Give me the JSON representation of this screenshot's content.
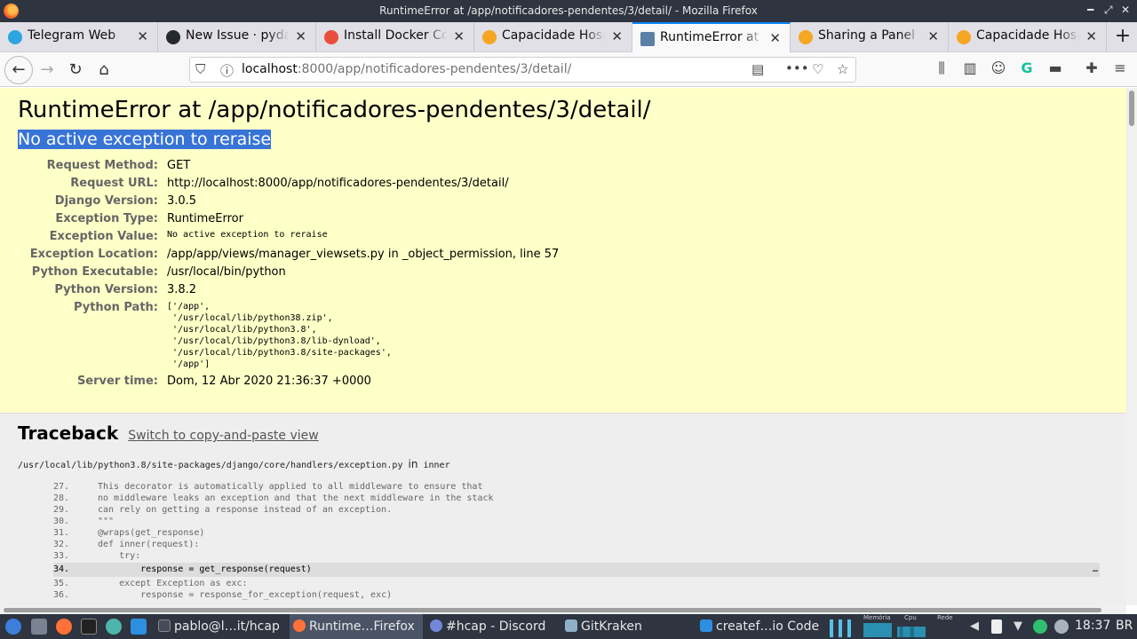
{
  "window": {
    "title": "RuntimeError at /app/notificadores-pendentes/3/detail/ - Mozilla Firefox"
  },
  "window_controls": {
    "minimize": "━",
    "maximize": "⤢",
    "close": "✕"
  },
  "tabs": [
    {
      "label": "Telegram Web",
      "color": "#2ca5e0"
    },
    {
      "label": "New Issue · pydantic",
      "color": "#24292e"
    },
    {
      "label": "Install Docker Compose",
      "color": "#e94e3c"
    },
    {
      "label": "Capacidade Hospitalar",
      "color": "#f5a623"
    },
    {
      "label": "RuntimeError at /app/",
      "color": "#5b7fa6"
    },
    {
      "label": "Sharing a Panel | Grafana",
      "color": "#f5a623"
    },
    {
      "label": "Capacidade Hospitalar",
      "color": "#f5a623"
    }
  ],
  "tab_close_glyph": "✕",
  "new_tab_glyph": "+",
  "nav": {
    "back": "←",
    "forward": "→",
    "reload": "↻",
    "home": "⌂",
    "url_host": "localhost",
    "url_path": ":8000/app/notificadores-pendentes/3/detail/",
    "info_icon": "ⓘ",
    "shield_icon": "⛉",
    "reader_icon": "▤",
    "more_icon": "•••",
    "pocket_icon": "♡",
    "star_icon": "☆"
  },
  "toolbar_icons": {
    "library": "⫼",
    "sidebar": "▥",
    "account": "☺",
    "grammarly": "G",
    "extension": "▬",
    "puzzle": "✚",
    "menu": "≡"
  },
  "error": {
    "heading": "RuntimeError at /app/notificadores-pendentes/3/detail/",
    "message": "No active exception to reraise",
    "meta": [
      {
        "label": "Request Method:",
        "value": "GET"
      },
      {
        "label": "Request URL:",
        "value": "http://localhost:8000/app/notificadores-pendentes/3/detail/"
      },
      {
        "label": "Django Version:",
        "value": "3.0.5"
      },
      {
        "label": "Exception Type:",
        "value": "RuntimeError"
      },
      {
        "label": "Exception Value:",
        "value": "No active exception to reraise"
      },
      {
        "label": "Exception Location:",
        "value": "/app/app/views/manager_viewsets.py in _object_permission, line 57"
      },
      {
        "label": "Python Executable:",
        "value": "/usr/local/bin/python"
      },
      {
        "label": "Python Version:",
        "value": "3.8.2"
      }
    ],
    "python_path_label": "Python Path:",
    "python_path": "['/app',\n '/usr/local/lib/python38.zip',\n '/usr/local/lib/python3.8',\n '/usr/local/lib/python3.8/lib-dynload',\n '/usr/local/lib/python3.8/site-packages',\n '/app']",
    "server_time_label": "Server time:",
    "server_time": "Dom, 12 Abr 2020 21:36:37 +0000"
  },
  "traceback": {
    "title": "Traceback",
    "switch_link": "Switch to copy-and-paste view",
    "file": "/usr/local/lib/python3.8/site-packages/django/core/handlers/exception.py",
    "in_word": "in",
    "function": "inner",
    "lines": [
      {
        "n": "27.",
        "code": "This decorator is automatically applied to all middleware to ensure that"
      },
      {
        "n": "28.",
        "code": "no middleware leaks an exception and that the next middleware in the stack"
      },
      {
        "n": "29.",
        "code": "can rely on getting a response instead of an exception."
      },
      {
        "n": "30.",
        "code": "\"\"\""
      },
      {
        "n": "31.",
        "code": "@wraps(get_response)"
      },
      {
        "n": "32.",
        "code": "def inner(request):"
      },
      {
        "n": "33.",
        "code": "    try:"
      },
      {
        "n": "34.",
        "code": "        response = get_response(request)",
        "current": true
      },
      {
        "n": "35.",
        "code": "    except Exception as exc:"
      },
      {
        "n": "36.",
        "code": "        response = response_for_exception(request, exc)"
      }
    ],
    "current_marker": "…"
  },
  "taskbar": {
    "tasks": [
      {
        "label": "pablo@l…it/hcap",
        "color": "#444c5c"
      },
      {
        "label": "Runtime…Firefox",
        "color": "#ff7139",
        "active": true
      },
      {
        "label": "#hcap - Discord",
        "color": "#7289da"
      },
      {
        "label": "GitKraken",
        "color": "#8fb0c8"
      },
      {
        "label": "createf…io Code",
        "color": "#2d8fe0"
      }
    ],
    "monitor_labels": [
      "Memória",
      "Cpu",
      "Rede"
    ],
    "clock": "18:37",
    "keyboard": "BR"
  }
}
